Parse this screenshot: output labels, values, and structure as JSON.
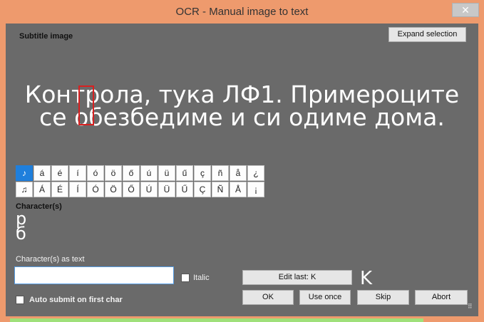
{
  "window": {
    "title": "OCR - Manual image to text",
    "close_icon": "close-icon"
  },
  "subtitle_image": {
    "label": "Subtitle image",
    "line1": "Контрола, тука ЛФ1. Примероците",
    "line2": "се обезбедиме и си одиме дома."
  },
  "expand_selection_label": "Expand selection",
  "special_chars": {
    "row1": [
      "♪",
      "á",
      "é",
      "í",
      "ó",
      "ö",
      "ő",
      "ú",
      "ü",
      "ű",
      "ç",
      "ñ",
      "å",
      "¿"
    ],
    "row2": [
      "♫",
      "Á",
      "É",
      "Í",
      "Ó",
      "Ö",
      "Ő",
      "Ú",
      "Ü",
      "Ű",
      "Ç",
      "Ñ",
      "Å",
      "¡"
    ]
  },
  "characters": {
    "label": "Character(s)",
    "preview": [
      "р",
      "б"
    ]
  },
  "text_entry": {
    "label": "Character(s) as text",
    "value": "",
    "italic_label": "Italic"
  },
  "auto_submit_label": "Auto submit on first char",
  "buttons": {
    "edit_last": "Edit last: K",
    "ok": "OK",
    "use_once": "Use once",
    "skip": "Skip",
    "abort": "Abort"
  },
  "last_char_preview": "K",
  "colors": {
    "titlebar": "#ee9a6d",
    "background": "#6a6a6a",
    "selected_cell": "#1f7fdc",
    "focus_box": "#d82020"
  }
}
